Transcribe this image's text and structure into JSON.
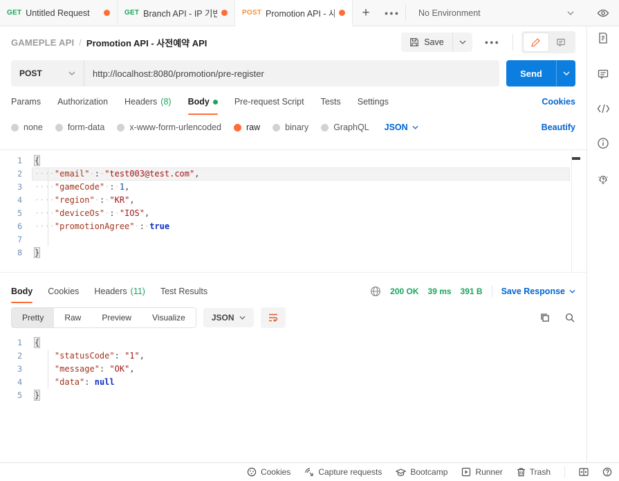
{
  "colors": {
    "accent_orange": "#ff6c37",
    "link_blue": "#0265d2",
    "send_blue": "#0b7ee0",
    "success_green": "#1ba55c",
    "method_get": "#1ba55c",
    "method_post": "#f59140"
  },
  "topbar": {
    "tabs": [
      {
        "method": "GET",
        "title": "Untitled Request"
      },
      {
        "method": "GET",
        "title": "Branch API - IP 기반 국"
      },
      {
        "method": "POST",
        "title": "Promotion API - 사전예"
      }
    ],
    "plus": "+",
    "more": "●●●",
    "environment": "No Environment"
  },
  "breadcrumb": {
    "collection": "GAMEPLE API",
    "separator": "/",
    "request_name": "Promotion API - 사전예약 API"
  },
  "header": {
    "save_label": "Save",
    "more": "●●●"
  },
  "request": {
    "method": "POST",
    "url": "http://localhost:8080/promotion/pre-register",
    "send_label": "Send",
    "tabs": {
      "params": "Params",
      "authorization": "Authorization",
      "headers_label": "Headers",
      "headers_count": "(8)",
      "body": "Body",
      "prerequest": "Pre-request Script",
      "tests": "Tests",
      "settings": "Settings"
    },
    "cookies_link": "Cookies",
    "modes": {
      "none": "none",
      "form_data": "form-data",
      "urlencoded": "x-www-form-urlencoded",
      "raw": "raw",
      "binary": "binary",
      "graphql": "GraphQL"
    },
    "language": "JSON",
    "beautify_link": "Beautify",
    "editor": {
      "lines": [
        {
          "n": "1",
          "tokens": [
            [
              "brace",
              "{"
            ]
          ]
        },
        {
          "n": "2",
          "hl": true,
          "tokens": [
            [
              "ws",
              "····"
            ],
            [
              "key",
              "\"email\""
            ],
            [
              "ws",
              "·"
            ],
            [
              "punc",
              ":"
            ],
            [
              "ws",
              "·"
            ],
            [
              "str",
              "\"test003@test.com\""
            ],
            [
              "punc",
              ","
            ]
          ]
        },
        {
          "n": "3",
          "tokens": [
            [
              "ws",
              "····"
            ],
            [
              "key",
              "\"gameCode\""
            ],
            [
              "ws",
              "·"
            ],
            [
              "punc",
              ":"
            ],
            [
              "ws",
              "·"
            ],
            [
              "num",
              "1"
            ],
            [
              "punc",
              ","
            ]
          ]
        },
        {
          "n": "4",
          "tokens": [
            [
              "ws",
              "····"
            ],
            [
              "key",
              "\"region\""
            ],
            [
              "ws",
              "·"
            ],
            [
              "punc",
              ":"
            ],
            [
              "ws",
              "·"
            ],
            [
              "str",
              "\"KR\""
            ],
            [
              "punc",
              ","
            ]
          ]
        },
        {
          "n": "5",
          "tokens": [
            [
              "ws",
              "····"
            ],
            [
              "key",
              "\"deviceOs\""
            ],
            [
              "ws",
              "·"
            ],
            [
              "punc",
              ":"
            ],
            [
              "ws",
              "·"
            ],
            [
              "str",
              "\"IOS\""
            ],
            [
              "punc",
              ","
            ]
          ]
        },
        {
          "n": "6",
          "tokens": [
            [
              "ws",
              "····"
            ],
            [
              "key",
              "\"promotionAgree\""
            ],
            [
              "ws",
              "·"
            ],
            [
              "punc",
              ":"
            ],
            [
              "ws",
              "·"
            ],
            [
              "bool",
              "true"
            ]
          ]
        },
        {
          "n": "7",
          "tokens": []
        },
        {
          "n": "8",
          "tokens": [
            [
              "brace",
              "}"
            ]
          ]
        }
      ]
    }
  },
  "response": {
    "tabs": {
      "body": "Body",
      "cookies": "Cookies",
      "headers_label": "Headers",
      "headers_count": "(11)",
      "test_results": "Test Results"
    },
    "status": {
      "code": "200 OK",
      "time": "39 ms",
      "size": "391 B"
    },
    "save_response_label": "Save Response",
    "views": {
      "pretty": "Pretty",
      "raw": "Raw",
      "preview": "Preview",
      "visualize": "Visualize"
    },
    "language": "JSON",
    "editor": {
      "lines": [
        {
          "n": "1",
          "tokens": [
            [
              "brace",
              "{"
            ]
          ]
        },
        {
          "n": "2",
          "tokens": [
            [
              "sp",
              "    "
            ],
            [
              "key",
              "\"statusCode\""
            ],
            [
              "punc",
              ":"
            ],
            [
              "sp",
              " "
            ],
            [
              "str",
              "\"1\""
            ],
            [
              "punc",
              ","
            ]
          ]
        },
        {
          "n": "3",
          "tokens": [
            [
              "sp",
              "    "
            ],
            [
              "key",
              "\"message\""
            ],
            [
              "punc",
              ":"
            ],
            [
              "sp",
              " "
            ],
            [
              "str",
              "\"OK\""
            ],
            [
              "punc",
              ","
            ]
          ]
        },
        {
          "n": "4",
          "tokens": [
            [
              "sp",
              "    "
            ],
            [
              "key",
              "\"data\""
            ],
            [
              "punc",
              ":"
            ],
            [
              "sp",
              " "
            ],
            [
              "bool",
              "null"
            ]
          ]
        },
        {
          "n": "5",
          "tokens": [
            [
              "brace",
              "}"
            ]
          ]
        }
      ]
    }
  },
  "statusbar": {
    "cookies": "Cookies",
    "capture": "Capture requests",
    "bootcamp": "Bootcamp",
    "runner": "Runner",
    "trash": "Trash"
  },
  "icons": {
    "right_rail": [
      "documentation-icon",
      "comments-icon",
      "code-snippet-icon",
      "info-icon",
      "lightbulb-icon"
    ],
    "status_right": [
      "two-pane-icon",
      "help-icon"
    ]
  }
}
